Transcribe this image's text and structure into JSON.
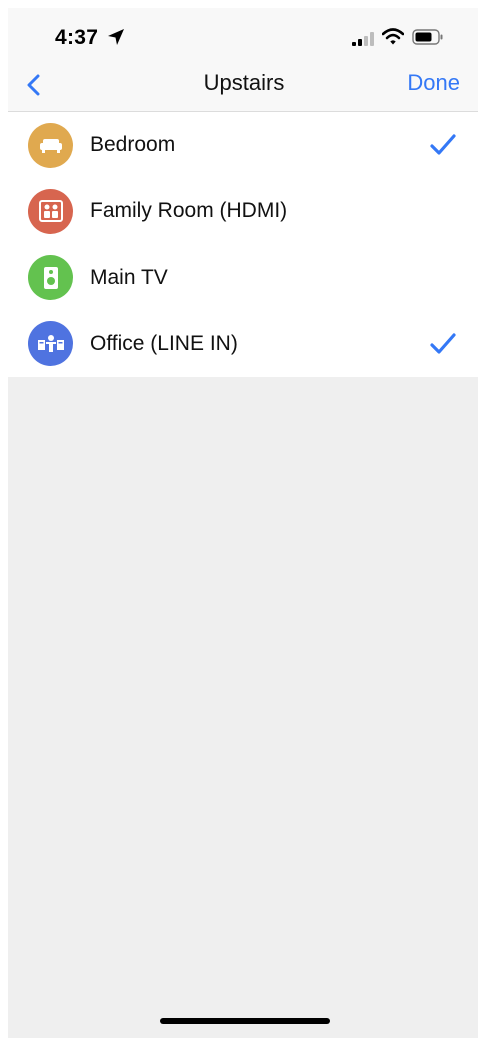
{
  "status_bar": {
    "time": "4:37",
    "icons": [
      "location-arrow-icon",
      "signal-icon",
      "wifi-icon",
      "battery-icon"
    ]
  },
  "nav": {
    "title": "Upstairs",
    "done_label": "Done",
    "back_icon": "chevron-left-icon"
  },
  "rooms": [
    {
      "label": "Bedroom",
      "icon": "couch-icon",
      "color": "#e0a94f",
      "selected": true
    },
    {
      "label": "Family Room (HDMI)",
      "icon": "tv-furniture-icon",
      "color": "#d7654f",
      "selected": false
    },
    {
      "label": "Main TV",
      "icon": "speaker-icon",
      "color": "#63c24f",
      "selected": false
    },
    {
      "label": "Office (LINE IN)",
      "icon": "desk-icon",
      "color": "#4f73e0",
      "selected": true
    }
  ],
  "colors": {
    "accent": "#3478f6",
    "background": "#efefef"
  }
}
